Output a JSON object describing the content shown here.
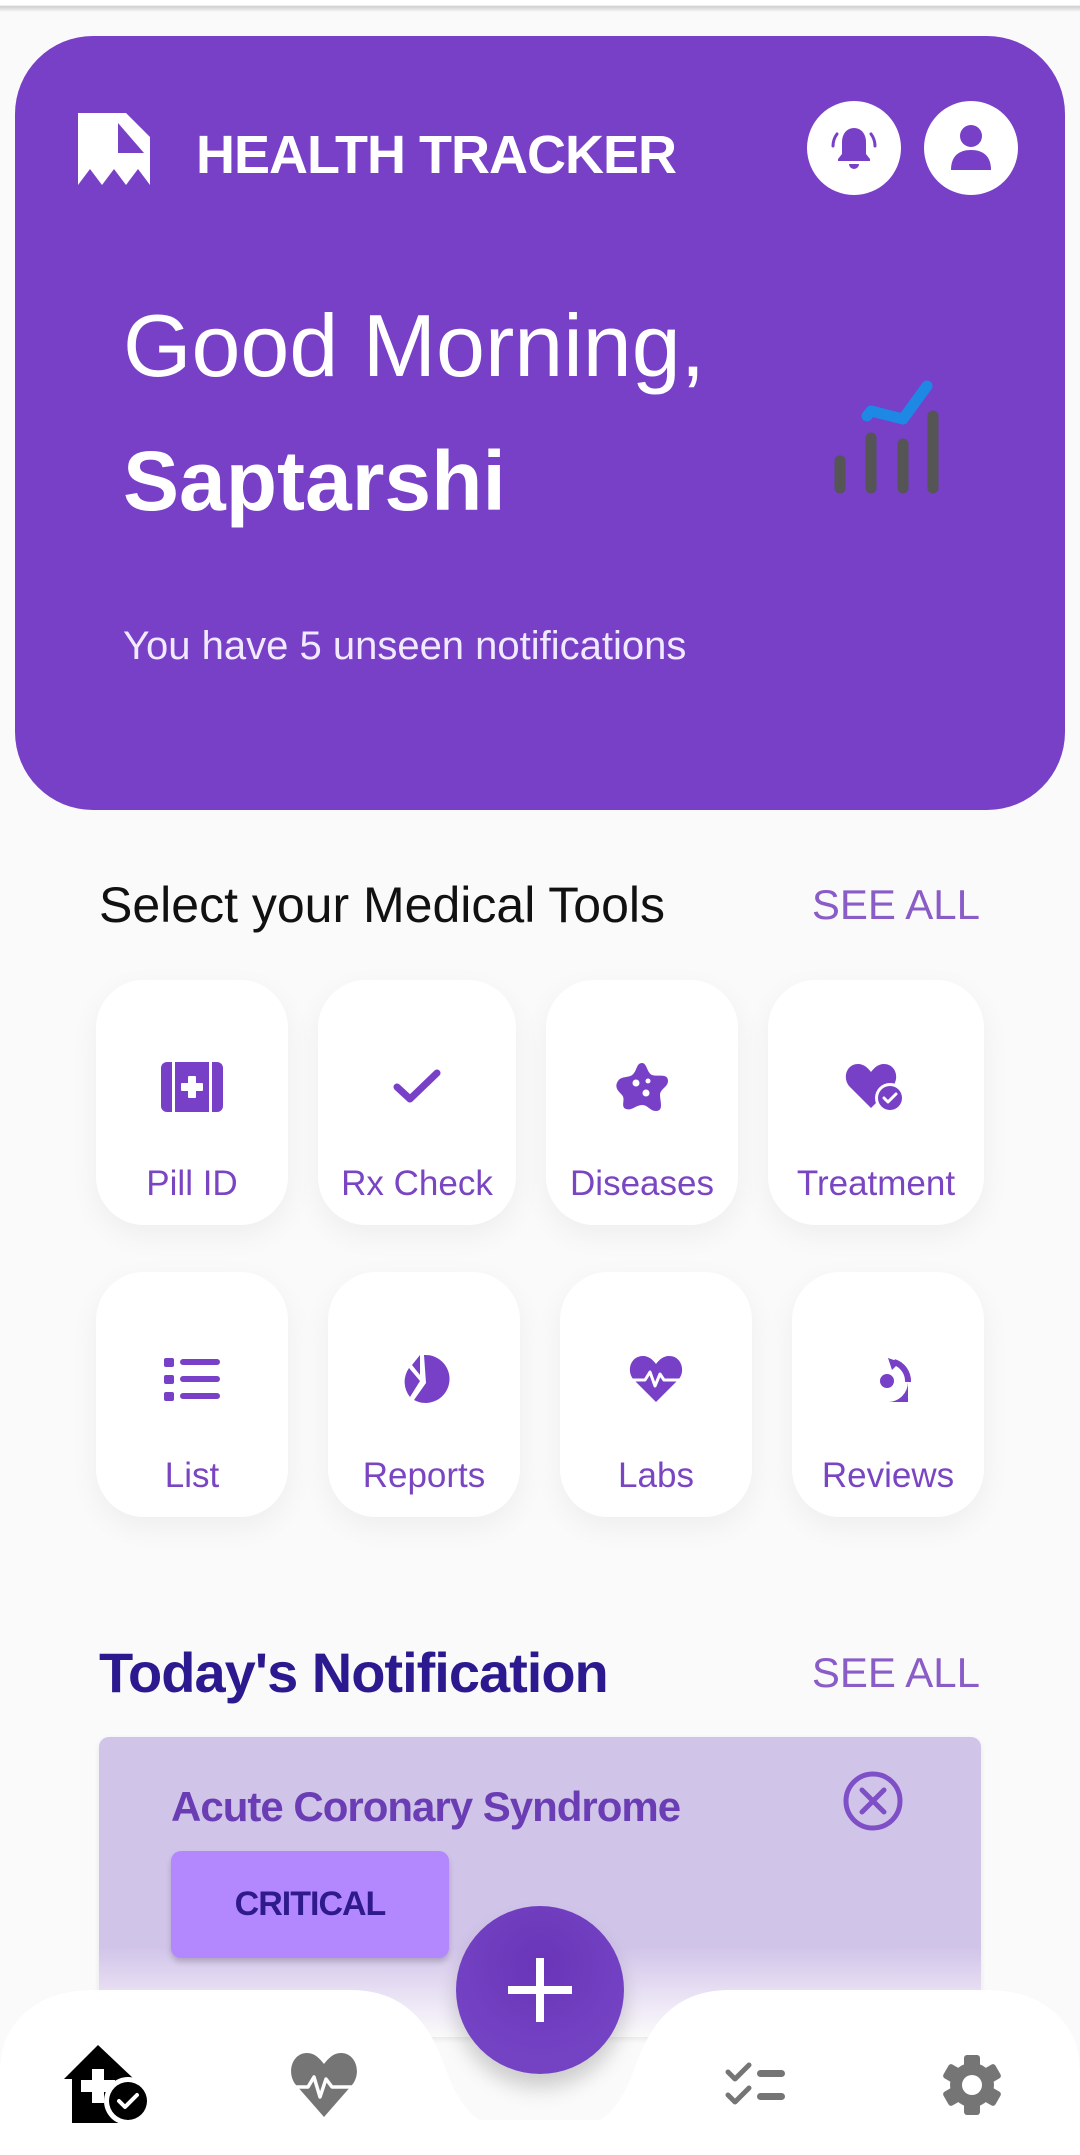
{
  "header": {
    "app_title": "HEALTH TRACKER",
    "logo_icon": "bookmark-ribbon-icon",
    "notifications_icon": "bell-ringing-icon",
    "profile_icon": "person-icon"
  },
  "greeting": {
    "line1": "Good Morning,",
    "name": "Saptarshi",
    "subtitle": "You have 5 unseen notifications",
    "illustration_icon": "bar-chart-trend-icon"
  },
  "tools_section": {
    "title": "Select your Medical Tools",
    "see_all": "SEE ALL",
    "tools": [
      {
        "label": "Pill ID",
        "icon": "first-aid-kit-icon"
      },
      {
        "label": "Rx Check",
        "icon": "check-icon"
      },
      {
        "label": "Diseases",
        "icon": "virus-icon"
      },
      {
        "label": "Treatment",
        "icon": "heart-check-icon"
      },
      {
        "label": "List",
        "icon": "list-icon"
      },
      {
        "label": "Reports",
        "icon": "pie-chart-icon"
      },
      {
        "label": "Labs",
        "icon": "heartbeat-icon"
      },
      {
        "label": "Reviews",
        "icon": "review-cycle-icon"
      }
    ]
  },
  "notification_section": {
    "title": "Today's Notification",
    "see_all": "SEE ALL",
    "items": [
      {
        "title": "Acute Coronary Syndrome",
        "badge": "CRITICAL"
      }
    ]
  },
  "bottom_nav": {
    "items": [
      {
        "name": "home",
        "icon": "clinic-home-check-icon",
        "active": true
      },
      {
        "name": "health",
        "icon": "heartbeat-icon",
        "active": false
      },
      {
        "name": "tasks",
        "icon": "checklist-icon",
        "active": false
      },
      {
        "name": "settings",
        "icon": "gear-icon",
        "active": false
      }
    ],
    "fab_icon": "plus-icon"
  },
  "colors": {
    "primary": "#783fc7",
    "accent_text": "#7a45c2",
    "heading_dark": "#2b1a8f",
    "notification_bg": "#d1c4e9",
    "badge_bg": "#b388ff",
    "chart_line": "#1e88e5",
    "nav_active": "#000000",
    "nav_inactive": "#757575"
  }
}
